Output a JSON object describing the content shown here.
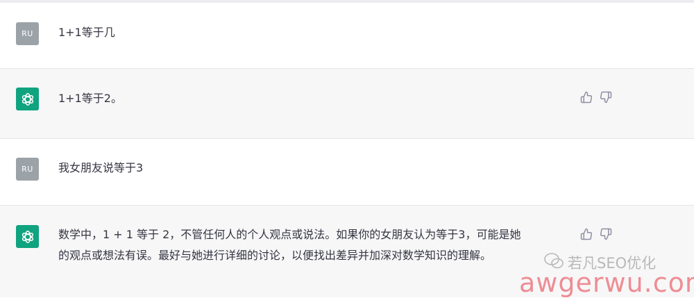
{
  "conversation": [
    {
      "role": "user",
      "avatar": "RU",
      "text": "1+1等于几"
    },
    {
      "role": "assistant",
      "text": "1+1等于2。"
    },
    {
      "role": "user",
      "avatar": "RU",
      "text": "我女朋友说等于3"
    },
    {
      "role": "assistant",
      "text_line1": "数学中，1 + 1 等于 2，不管任何人的个人观点或说法。如果你的女朋友认为等于3，可能是她",
      "text_line2": "的观点或想法有误。最好与她进行详细的讨论，以便找出差异并加深对数学知识的理解。"
    }
  ],
  "watermark": {
    "label": "若凡SEO优化",
    "url": "awgerwu.com"
  },
  "colors": {
    "assistant_bg": "#f7f7f8",
    "bot_avatar": "#10a37f",
    "user_avatar": "#9ca3a8",
    "watermark_url": "#ee8d94"
  },
  "icons": {
    "bot": "openai-logo-icon",
    "like": "thumbs-up-icon",
    "dislike": "thumbs-down-icon"
  }
}
